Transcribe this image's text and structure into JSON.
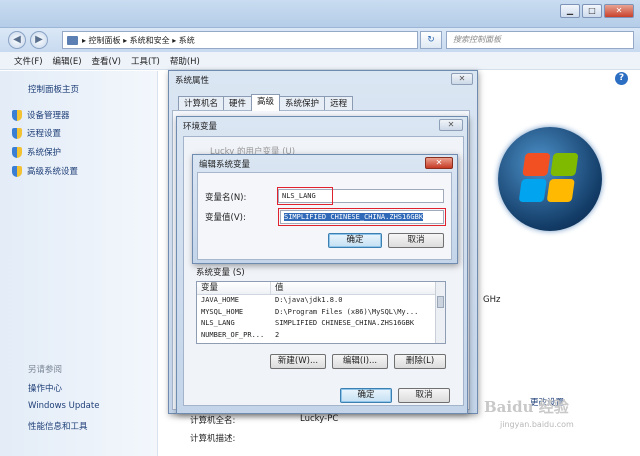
{
  "window": {
    "minimize": "▁",
    "maximize": "□",
    "close": "✕"
  },
  "nav": {
    "back": "◀",
    "forward": "▶",
    "breadcrumb": "▸ 控制面板 ▸ 系统和安全 ▸ 系统",
    "refresh": "↻",
    "search_placeholder": "搜索控制面板"
  },
  "menu": {
    "items": [
      "文件(F)",
      "编辑(E)",
      "查看(V)",
      "工具(T)",
      "帮助(H)"
    ]
  },
  "left": {
    "home": "控制面板主页",
    "links": [
      "设备管理器",
      "远程设置",
      "系统保护",
      "高级系统设置"
    ],
    "see_also_title": "另请参阅",
    "see_also": [
      "操作中心",
      "Windows Update",
      "性能信息和工具"
    ]
  },
  "main": {
    "ghz": "GHz",
    "computer_name_label": "计算机全名:",
    "computer_name_value": "Lucky-PC",
    "computer_desc_label": "计算机描述:",
    "change_settings": "更改设置"
  },
  "sys_props": {
    "title": "系统属性",
    "tabs": [
      "计算机名",
      "硬件",
      "高级",
      "系统保护",
      "远程"
    ],
    "active_tab": 2
  },
  "env_vars": {
    "title": "环境变量",
    "user_vars_label": "Lucky 的用户变量 (U)",
    "system_vars_label": "系统变量 (S)",
    "columns": [
      "变量",
      "值"
    ],
    "rows": [
      [
        "JAVA_HOME",
        "D:\\java\\jdk1.8.0"
      ],
      [
        "MYSQL_HOME",
        "D:\\Program Files (x86)\\MySQL\\My..."
      ],
      [
        "NLS_LANG",
        "SIMPLIFIED CHINESE_CHINA.ZHS16GBK"
      ],
      [
        "NUMBER_OF_PR...",
        "2"
      ]
    ],
    "new_button": "新建(W)...",
    "edit_button": "编辑(I)...",
    "delete_button": "删除(L)",
    "ok_button": "确定",
    "cancel_button": "取消"
  },
  "edit_dialog": {
    "title": "编辑系统变量",
    "name_label": "变量名(N):",
    "name_value": "NLS_LANG",
    "value_label": "变量值(V):",
    "value_value": "SIMPLIFIED CHINESE_CHINA.ZHS16GBK",
    "ok_button": "确定",
    "cancel_button": "取消"
  },
  "watermark": {
    "brand": "Baidu 经验",
    "url": "jingyan.baidu.com"
  }
}
